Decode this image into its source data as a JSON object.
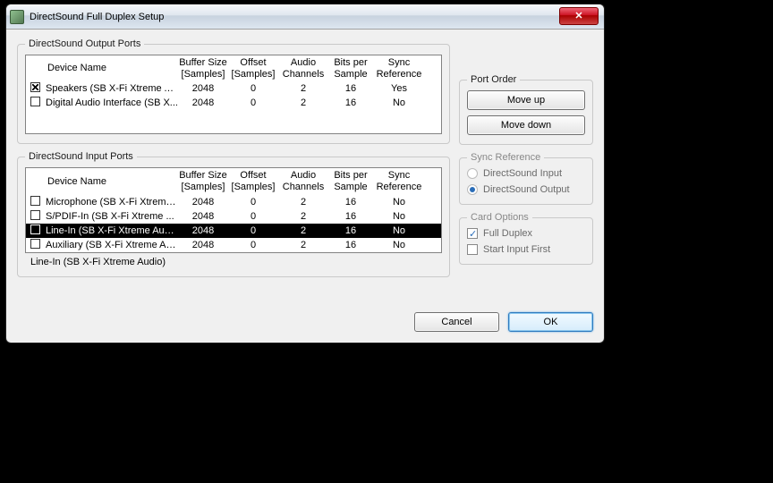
{
  "window": {
    "title": "DirectSound Full Duplex Setup"
  },
  "outputPorts": {
    "legend": "DirectSound Output Ports",
    "headers": {
      "device": "Device Name",
      "buffer": "Buffer Size [Samples]",
      "offset": "Offset [Samples]",
      "channels": "Audio Channels",
      "bits": "Bits per Sample",
      "sync": "Sync Reference"
    },
    "rows": [
      {
        "checked": true,
        "name": "Speakers (SB X-Fi Xtreme A...",
        "buffer": 2048,
        "offset": 0,
        "channels": 2,
        "bits": 16,
        "sync": "Yes"
      },
      {
        "checked": false,
        "name": "Digital Audio Interface (SB X...",
        "buffer": 2048,
        "offset": 0,
        "channels": 2,
        "bits": 16,
        "sync": "No"
      }
    ]
  },
  "inputPorts": {
    "legend": "DirectSound Input Ports",
    "headers": {
      "device": "Device Name",
      "buffer": "Buffer Size [Samples]",
      "offset": "Offset [Samples]",
      "channels": "Audio Channels",
      "bits": "Bits per Sample",
      "sync": "Sync Reference"
    },
    "rows": [
      {
        "checked": false,
        "name": "Microphone (SB X-Fi Xtreme...",
        "buffer": 2048,
        "offset": 0,
        "channels": 2,
        "bits": 16,
        "sync": "No",
        "selected": false
      },
      {
        "checked": false,
        "name": "S/PDIF-In (SB X-Fi Xtreme ...",
        "buffer": 2048,
        "offset": 0,
        "channels": 2,
        "bits": 16,
        "sync": "No",
        "selected": false
      },
      {
        "checked": false,
        "name": "Line-In (SB X-Fi Xtreme Audio)",
        "buffer": 2048,
        "offset": 0,
        "channels": 2,
        "bits": 16,
        "sync": "No",
        "selected": true
      },
      {
        "checked": false,
        "name": "Auxiliary (SB X-Fi Xtreme Audio)",
        "buffer": 2048,
        "offset": 0,
        "channels": 2,
        "bits": 16,
        "sync": "No",
        "selected": false
      }
    ],
    "selectedCaption": "Line-In (SB X-Fi Xtreme Audio)"
  },
  "portOrder": {
    "legend": "Port Order",
    "moveUp": "Move up",
    "moveDown": "Move down"
  },
  "syncRef": {
    "legend": "Sync Reference",
    "input": "DirectSound Input",
    "output": "DirectSound Output",
    "selected": "output"
  },
  "cardOptions": {
    "legend": "Card Options",
    "fullDuplex": {
      "label": "Full Duplex",
      "checked": true
    },
    "startInputFirst": {
      "label": "Start Input First",
      "checked": false
    }
  },
  "buttons": {
    "cancel": "Cancel",
    "ok": "OK"
  }
}
